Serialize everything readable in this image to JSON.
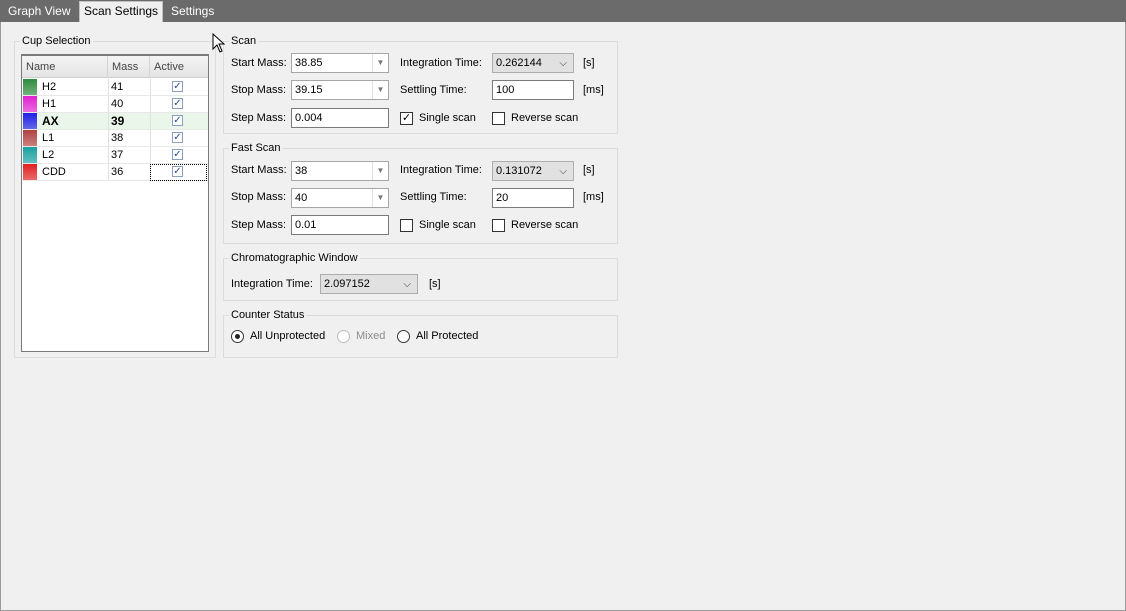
{
  "tabs": [
    {
      "label": "Graph View"
    },
    {
      "label": "Scan Settings"
    },
    {
      "label": "Settings"
    }
  ],
  "cup_selection": {
    "title": "Cup Selection",
    "columns": [
      "Name",
      "Mass",
      "Active"
    ],
    "rows": [
      {
        "name": "H2",
        "mass": "41",
        "active": true,
        "color": "#2e8b3e"
      },
      {
        "name": "H1",
        "mass": "40",
        "active": true,
        "color": "#e020d0"
      },
      {
        "name": "AX",
        "mass": "39",
        "active": true,
        "color": "#2020e8"
      },
      {
        "name": "L1",
        "mass": "38",
        "active": true,
        "color": "#b04040"
      },
      {
        "name": "L2",
        "mass": "37",
        "active": true,
        "color": "#18a0a0"
      },
      {
        "name": "CDD",
        "mass": "36",
        "active": true,
        "color": "#e02020"
      }
    ]
  },
  "scan": {
    "title": "Scan",
    "start_mass_label": "Start Mass:",
    "start_mass": "38.85",
    "stop_mass_label": "Stop Mass:",
    "stop_mass": "39.15",
    "step_mass_label": "Step Mass:",
    "step_mass": "0.004",
    "integration_time_label": "Integration Time:",
    "integration_time": "0.262144",
    "integration_unit": "[s]",
    "settling_time_label": "Settling Time:",
    "settling_time": "100",
    "settling_unit": "[ms]",
    "single_scan_label": "Single scan",
    "single_scan": true,
    "reverse_scan_label": "Reverse scan",
    "reverse_scan": false
  },
  "fast_scan": {
    "title": "Fast Scan",
    "start_mass_label": "Start Mass:",
    "start_mass": "38",
    "stop_mass_label": "Stop Mass:",
    "stop_mass": "40",
    "step_mass_label": "Step Mass:",
    "step_mass": "0.01",
    "integration_time_label": "Integration Time:",
    "integration_time": "0.131072",
    "integration_unit": "[s]",
    "settling_time_label": "Settling Time:",
    "settling_time": "20",
    "settling_unit": "[ms]",
    "single_scan_label": "Single scan",
    "single_scan": false,
    "reverse_scan_label": "Reverse scan",
    "reverse_scan": false
  },
  "chromatographic_window": {
    "title": "Chromatographic Window",
    "integration_time_label": "Integration Time:",
    "integration_time": "2.097152",
    "unit": "[s]"
  },
  "counter_status": {
    "title": "Counter Status",
    "options": [
      {
        "label": "All Unprotected",
        "selected": true,
        "enabled": true
      },
      {
        "label": "Mixed",
        "selected": false,
        "enabled": false
      },
      {
        "label": "All Protected",
        "selected": false,
        "enabled": true
      }
    ]
  }
}
